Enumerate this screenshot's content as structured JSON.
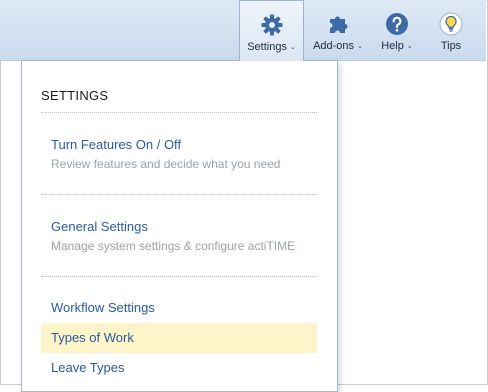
{
  "topnav": {
    "settings": "Settings",
    "addons": "Add-ons",
    "help": "Help",
    "tips": "Tips",
    "caret": "⌄"
  },
  "dropdown": {
    "title": "SETTINGS",
    "sections": [
      {
        "link": "Turn Features On / Off",
        "description": "Review features and decide what you need"
      },
      {
        "link": "General Settings",
        "description": "Manage system settings & configure actiTIME"
      }
    ],
    "items": [
      "Workflow Settings",
      "Types of Work",
      "Leave Types"
    ],
    "highlighted_item": "Types of Work"
  },
  "colors": {
    "link": "#2a5a9c",
    "highlight": "#fdf5c9",
    "icon": "#3c6aa6"
  },
  "icons": {
    "settings": "gear-icon",
    "addons": "puzzle-icon",
    "help": "question-circle-icon",
    "tips": "lightbulb-icon"
  }
}
